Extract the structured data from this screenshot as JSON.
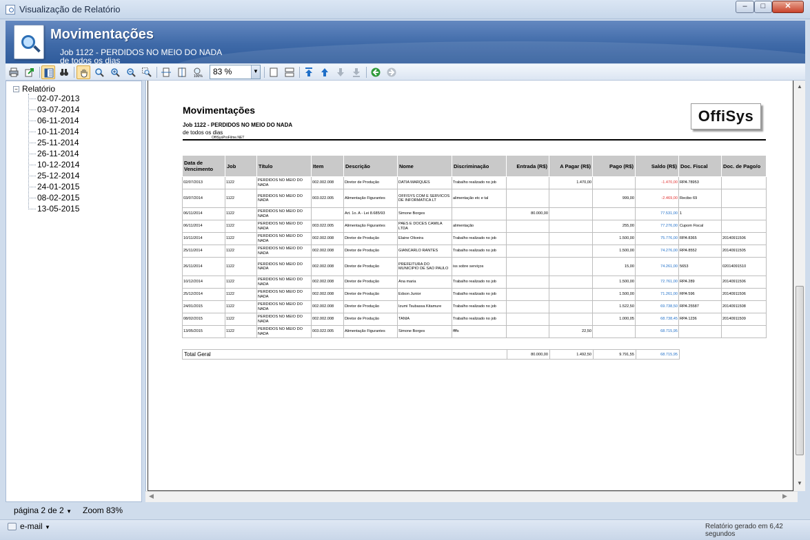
{
  "window": {
    "title": "Visualização de Relatório",
    "minimize": "–",
    "maximize": "□",
    "close": "✕"
  },
  "banner": {
    "title": "Movimentações",
    "subtitle1": "Job 1122 - PERDIDOS NO MEIO DO NADA",
    "subtitle2": "de todos os dias"
  },
  "toolbar": {
    "zoom_value": "83 %",
    "buttons": [
      "print-icon",
      "export-icon",
      "document-map-icon",
      "find-icon",
      "hand-tool-icon",
      "magnifier-icon",
      "zoom-in-icon",
      "zoom-out-icon",
      "zoom-rect-icon",
      "page-width-icon",
      "whole-page-icon",
      "zoom-100-icon",
      "single-page-icon",
      "multi-page-icon",
      "first-page-icon",
      "previous-page-icon",
      "next-page-icon",
      "last-page-icon",
      "back-icon",
      "forward-icon"
    ]
  },
  "tree": {
    "root": "Relatório",
    "items": [
      "02-07-2013",
      "03-07-2014",
      "06-11-2014",
      "10-11-2014",
      "25-11-2014",
      "26-11-2014",
      "10-12-2014",
      "25-12-2014",
      "24-01-2015",
      "08-02-2015",
      "13-05-2015"
    ]
  },
  "report": {
    "title": "Movimentações",
    "subtitle1": "Job 1122 - PERDIDOS NO MEIO DO NADA",
    "subtitle2": "de todos os dias",
    "credit": "OffiSysProFilme.NET",
    "logo": "OffiSys",
    "headers": [
      "Data de Vencimento",
      "Job",
      "Título",
      "Item",
      "Descrição",
      "Nome",
      "Discriminação",
      "Entrada (R$)",
      "A Pagar (R$)",
      "Pago (R$)",
      "Saldo (R$)",
      "Doc. Fiscal",
      "Doc. de Pago/o"
    ],
    "rows": [
      [
        "02/07/2013",
        "1122",
        "PERDIDOS NO MEIO DO NADA",
        "002.002.008",
        "Diretor de Produção",
        "DATIA MARQUES",
        "Trabalho realizado no job",
        "",
        "1.470,00",
        "",
        "-1.470,00",
        "RPA 78953",
        ""
      ],
      [
        "03/07/2014",
        "1122",
        "PERDIDOS NO MEIO DO NADA",
        "003.022.005",
        "Alimentação Figurantes",
        "OFFISYS COM E SERVICOS DE INFORMATICA LT",
        "alimentação etc e tal",
        "",
        "",
        "999,00",
        "-2.469,00",
        "Recibo 69",
        ""
      ],
      [
        "06/11/2014",
        "1122",
        "PERDIDOS NO MEIO DO NADA",
        "",
        "Art. 1o. A - Lei 8.685/93",
        "Simone Borges",
        "",
        "80.000,00",
        "",
        "",
        "77.531,00",
        "1",
        ""
      ],
      [
        "06/11/2014",
        "1122",
        "PERDIDOS NO MEIO DO NADA",
        "003.022.005",
        "Alimentação Figurantes",
        "PAES E DOCES CAMILA LTDA",
        "alimentação",
        "",
        "",
        "255,00",
        "77.276,00",
        "Cupom Fiscal",
        ""
      ],
      [
        "10/11/2014",
        "1122",
        "PERDIDOS NO MEIO DO NADA",
        "002.002.008",
        "Diretor de Produção",
        "Elaine Oliveira",
        "Trabalho realizado no job",
        "",
        "",
        "1.500,00",
        "75.776,00",
        "RPA 8365",
        "20140911506"
      ],
      [
        "25/11/2014",
        "1122",
        "PERDIDOS NO MEIO DO NADA",
        "002.002.008",
        "Diretor de Produção",
        "GIANCARLO RANTES",
        "Trabalho realizado no job",
        "",
        "",
        "1.500,00",
        "74.276,00",
        "RPA 8552",
        "20140911505"
      ],
      [
        "26/11/2014",
        "1122",
        "PERDIDOS NO MEIO DO NADA",
        "002.002.008",
        "Diretor de Produção",
        "PREFEITURA DO MUNICIPIO DE SAO PAULO",
        "iss sobre serviços",
        "",
        "",
        "15,00",
        "74.261,00",
        "5653",
        "02014091510"
      ],
      [
        "10/12/2014",
        "1122",
        "PERDIDOS NO MEIO DO NADA",
        "002.002.008",
        "Diretor de Produção",
        "Ana maria",
        "Trabalho realizado no job",
        "",
        "",
        "1.500,00",
        "72.761,00",
        "RPA 289",
        "20140911506"
      ],
      [
        "25/12/2014",
        "1122",
        "PERDIDOS NO MEIO DO NADA",
        "002.002.008",
        "Diretor de Produção",
        "Edson Junior",
        "Trabalho realizado no job",
        "",
        "",
        "1.500,00",
        "71.261,00",
        "RPA 596",
        "20140911506"
      ],
      [
        "24/01/2015",
        "1122",
        "PERDIDOS NO MEIO DO NADA",
        "002.002.008",
        "Diretor de Produção",
        "Izumi Tsubassa Kitamure",
        "Trabalho realizado no job",
        "",
        "",
        "1.522,50",
        "69.738,50",
        "RPA 25587",
        "20140911508"
      ],
      [
        "08/02/2015",
        "1122",
        "PERDIDOS NO MEIO DO NADA",
        "002.002.008",
        "Diretor de Produção",
        "TANIA",
        "Trabalho realizado no job",
        "",
        "",
        "1.000,05",
        "68.738,45",
        "RPA 1236",
        "20140911509"
      ],
      [
        "13/05/2015",
        "1122",
        "PERDIDOS NO MEIO DO NADA",
        "003.022.005",
        "Alimentação Figurantes",
        "Simone Borges",
        "ffffs",
        "",
        "22,50",
        "",
        "68.715,95",
        "",
        ""
      ]
    ],
    "total": {
      "label": "Total Geral",
      "entrada": "80.000,00",
      "a_pagar": "1.492,50",
      "pago": "9.791,55",
      "saldo": "68.715,95"
    }
  },
  "status": {
    "page": "página 2 de 2",
    "zoom": "Zoom 83%",
    "email": "e-mail",
    "generated": "Relatório gerado em 6,42 segundos"
  },
  "colors": {
    "negative": "#e03030",
    "positive": "#1f6fc8",
    "banner": "#3f6aa8"
  }
}
